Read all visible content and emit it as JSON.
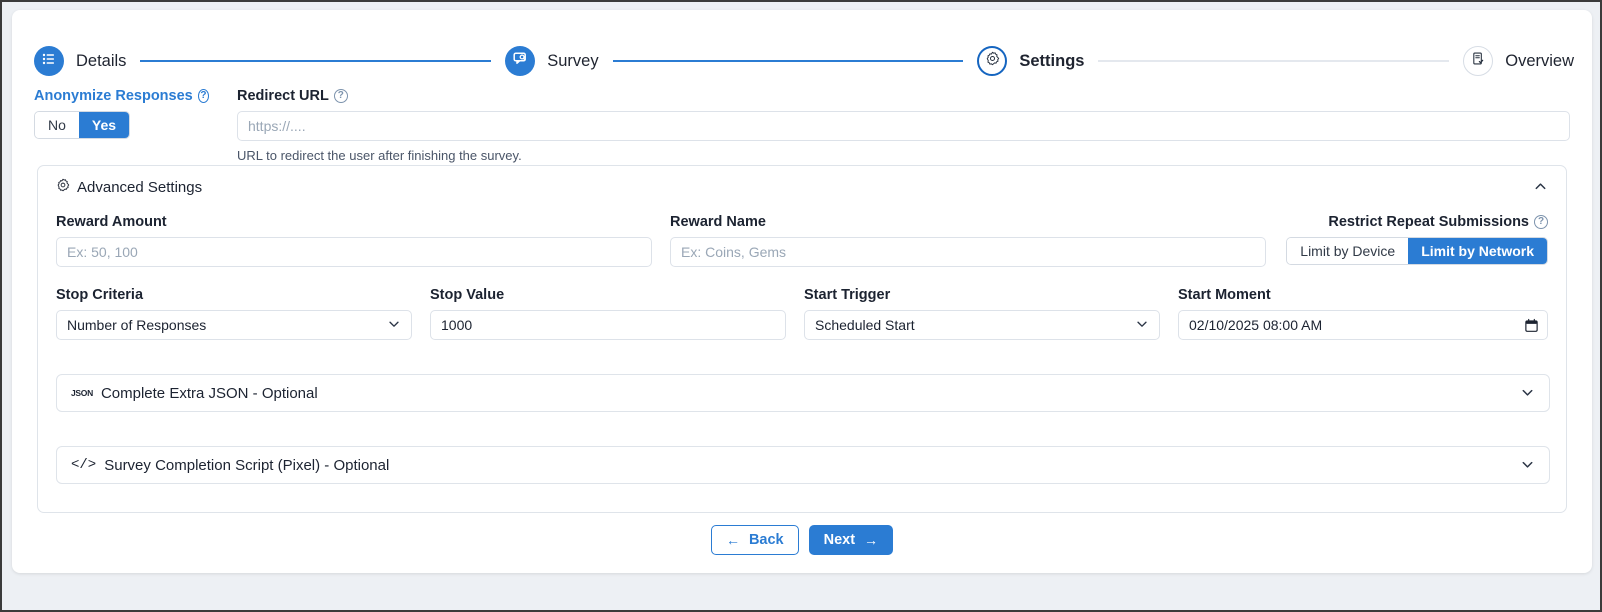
{
  "stepper": {
    "steps": [
      {
        "label": "Details",
        "icon": "list-icon",
        "state": "done"
      },
      {
        "label": "Survey",
        "icon": "survey-search-icon",
        "state": "done"
      },
      {
        "label": "Settings",
        "icon": "gear-icon",
        "state": "active"
      },
      {
        "label": "Overview",
        "icon": "document-check-icon",
        "state": "todo"
      }
    ]
  },
  "top": {
    "anonymize": {
      "label": "Anonymize Responses",
      "help_icon": "question-circle-icon",
      "options": [
        "No",
        "Yes"
      ],
      "selected": "Yes"
    },
    "redirect": {
      "label": "Redirect URL",
      "help_icon": "question-circle-icon",
      "value": "",
      "placeholder": "https://....",
      "hint": "URL to redirect the user after finishing the survey."
    }
  },
  "advanced": {
    "title": "Advanced Settings",
    "icon": "gear-icon",
    "collapse_icon": "chevron-up-icon",
    "reward_amount": {
      "label": "Reward Amount",
      "value": "",
      "placeholder": "Ex: 50, 100"
    },
    "reward_name": {
      "label": "Reward Name",
      "value": "",
      "placeholder": "Ex: Coins, Gems"
    },
    "restrict": {
      "label": "Restrict Repeat Submissions",
      "help_icon": "question-circle-icon",
      "options": [
        "Limit by Device",
        "Limit by Network"
      ],
      "selected": "Limit by Network"
    },
    "stop_criteria": {
      "label": "Stop Criteria",
      "value": "Number of Responses",
      "icon": "chevron-down-icon"
    },
    "stop_value": {
      "label": "Stop Value",
      "value": "1000",
      "placeholder": ""
    },
    "start_trigger": {
      "label": "Start Trigger",
      "value": "Scheduled Start",
      "icon": "chevron-down-icon"
    },
    "start_moment": {
      "label": "Start Moment",
      "value": "02/10/2025 08:00 AM",
      "icon": "calendar-icon"
    },
    "sections": [
      {
        "label": "Complete Extra JSON - Optional",
        "icon": "json-icon",
        "collapse_icon": "chevron-down-icon"
      },
      {
        "label": "Survey Completion Script (Pixel) - Optional",
        "icon": "code-icon",
        "collapse_icon": "chevron-down-icon"
      }
    ]
  },
  "footer": {
    "back": {
      "label": "Back",
      "icon": "arrow-left-icon"
    },
    "next": {
      "label": "Next",
      "icon": "arrow-right-icon"
    }
  },
  "colors": {
    "accent": "#2b7cd3",
    "active_step_border": "#1565c0",
    "page_background": "#edf0f4",
    "card_background": "#ffffff",
    "border": "#dfe4ea",
    "placeholder": "#9aa7b6"
  }
}
